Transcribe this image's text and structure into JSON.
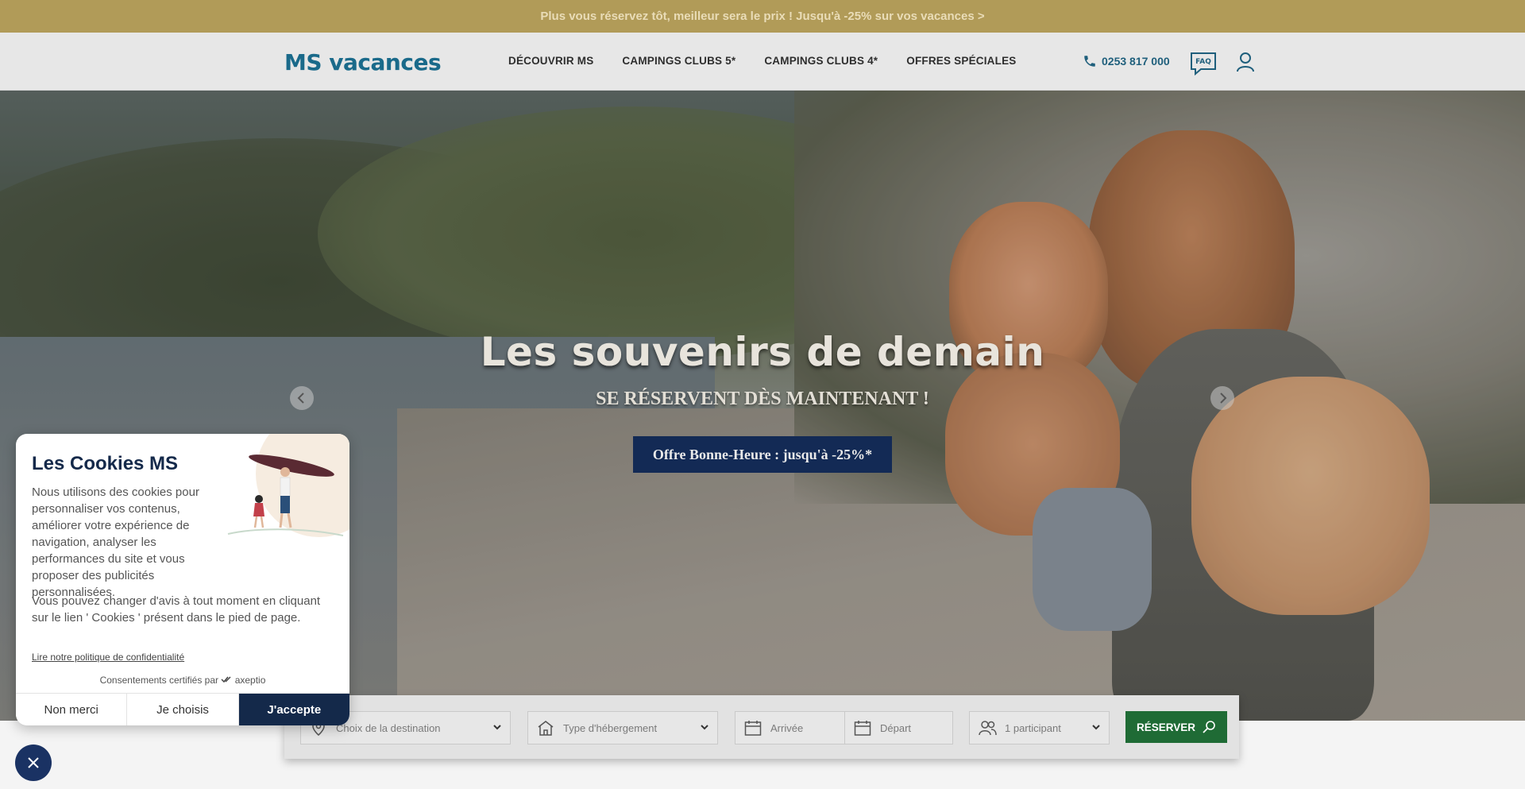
{
  "promo": {
    "text": "Plus vous réservez tôt, meilleur sera le prix ! Jusqu'à -25% sur vos vacances >"
  },
  "header": {
    "logo": "MS vacances",
    "nav": [
      "DÉCOUVRIR MS",
      "CAMPINGS CLUBS 5*",
      "CAMPINGS CLUBS 4*",
      "OFFRES SPÉCIALES"
    ],
    "phone": "0253 817 000",
    "faq_label": "FAQ"
  },
  "hero": {
    "title": "Les souvenirs de demain",
    "subtitle": "SE RÉSERVENT DÈS MAINTENANT !",
    "cta": "Offre Bonne-Heure : jusqu'à -25%*"
  },
  "search": {
    "destination": "Choix de la destination",
    "accommodation": "Type d'hébergement",
    "arrival": "Arrivée",
    "departure": "Départ",
    "participants": "1 participant",
    "reserve": "RÉSERVER"
  },
  "cookie": {
    "title": "Les Cookies MS",
    "paragraph1": "Nous utilisons des cookies pour personnaliser vos contenus, améliorer votre expérience de navigation, analyser les performances du site et vous proposer des publicités personnalisées.",
    "paragraph2": "Vous pouvez changer d'avis à tout moment en cliquant sur le lien ' Cookies ' présent dans le pied de page.",
    "policy_link": "Lire notre politique de confidentialité",
    "certified": "Consentements certifiés par",
    "certifier": "axeptio",
    "buttons": {
      "refuse": "Non merci",
      "choose": "Je choisis",
      "accept": "J'accepte"
    }
  },
  "colors": {
    "promo_bg": "#b19b58",
    "navy": "#14294a",
    "reserve_green": "#1f6b35",
    "logo_blue": "#1a6a8a"
  }
}
